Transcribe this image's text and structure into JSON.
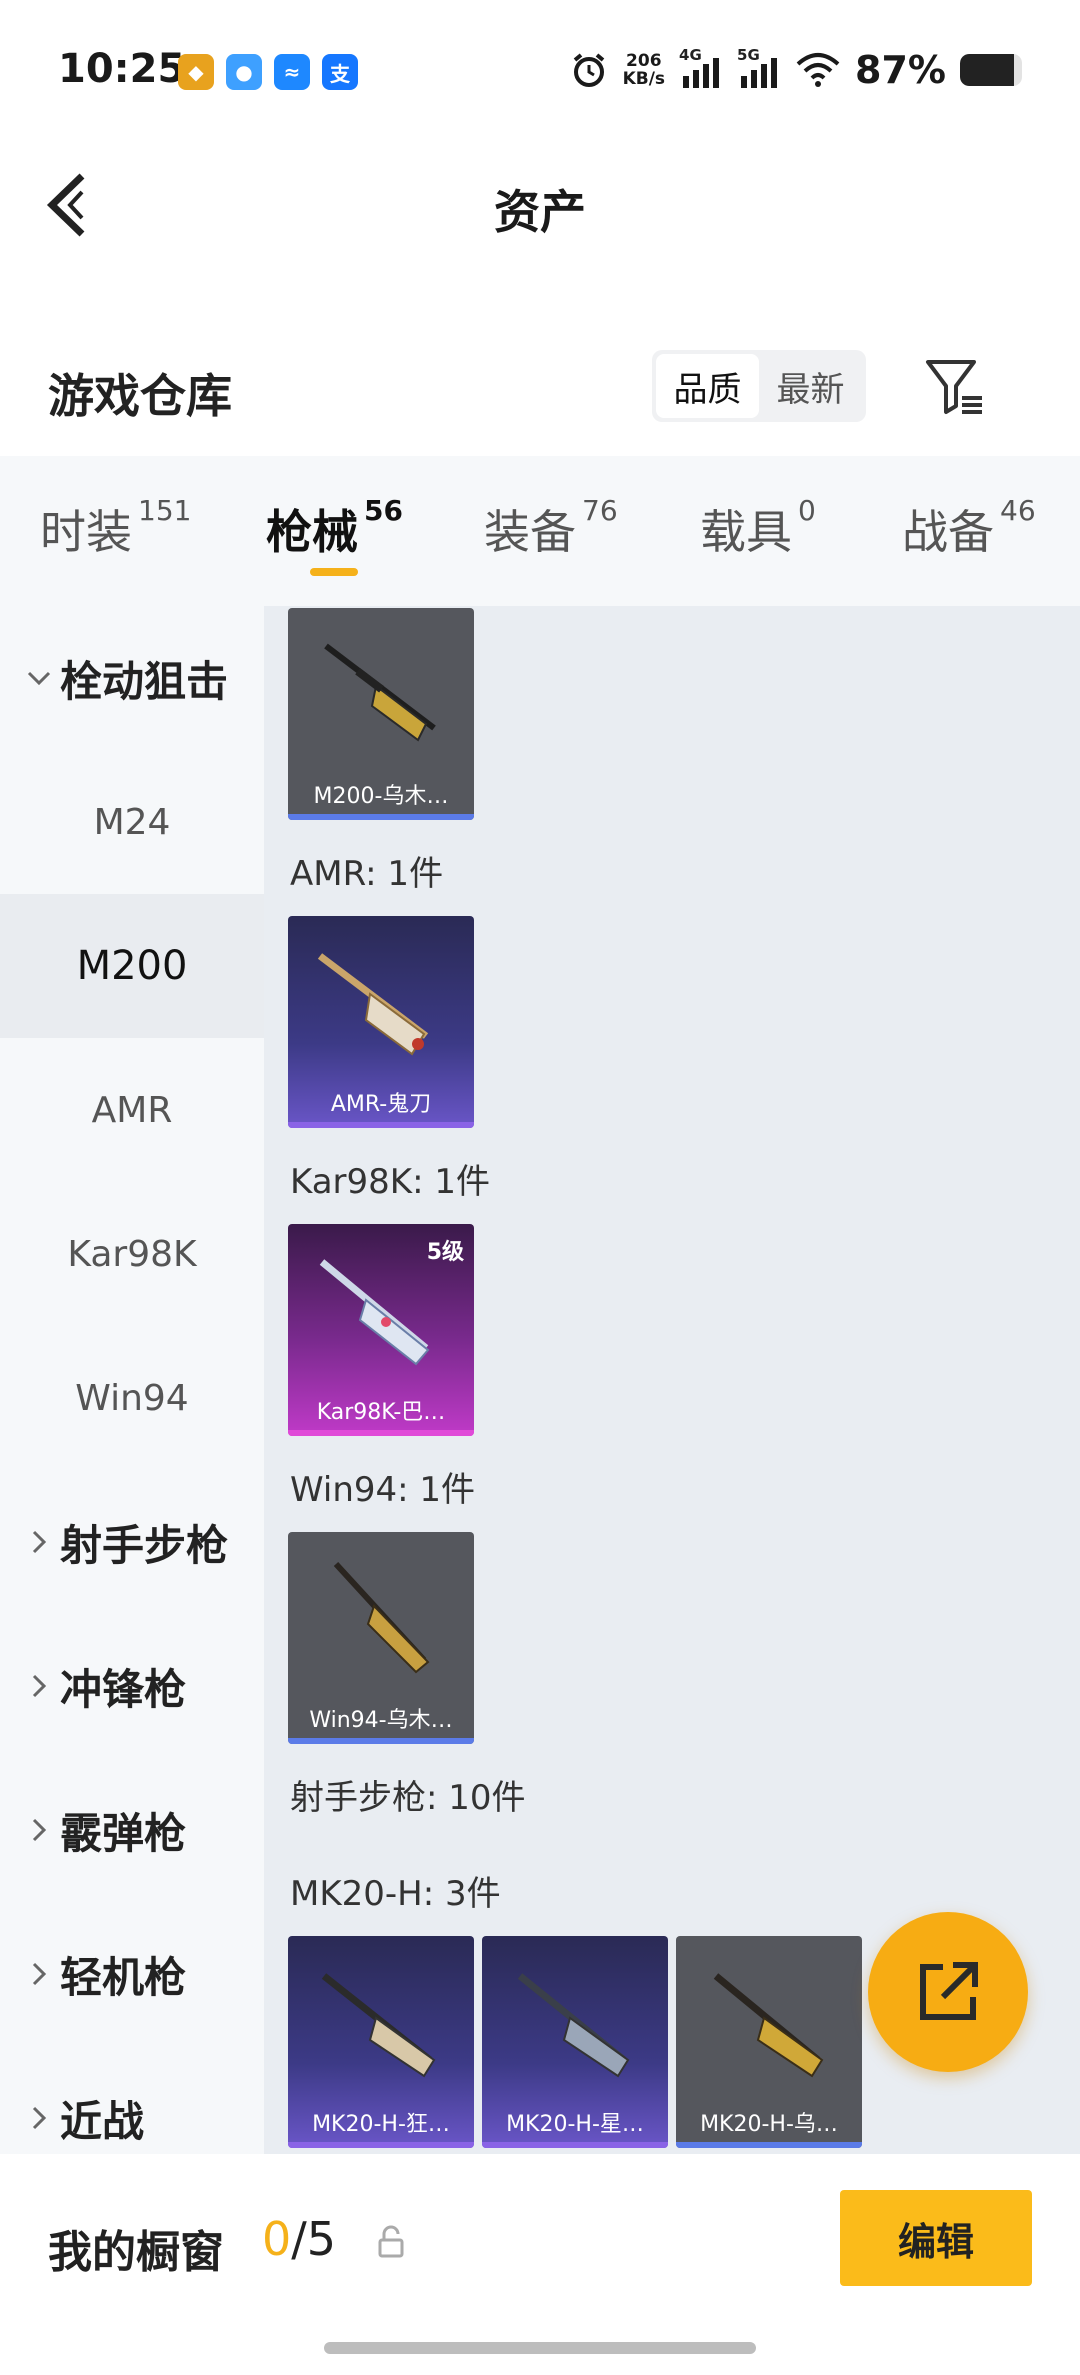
{
  "status_bar": {
    "time": "10:25",
    "speed_value": "206",
    "speed_unit": "KB/s",
    "network_1": "4G",
    "network_2": "5G",
    "battery_percent": "87%",
    "battery_level": 0.87
  },
  "header": {
    "title": "资产"
  },
  "warehouse": {
    "title": "游戏仓库",
    "sort_options": [
      "品质",
      "最新"
    ],
    "sort_selected": "品质"
  },
  "tabs": [
    {
      "label": "时装",
      "count": "151"
    },
    {
      "label": "枪械",
      "count": "56",
      "active": true
    },
    {
      "label": "装备",
      "count": "76"
    },
    {
      "label": "载具",
      "count": "0"
    },
    {
      "label": "战备",
      "count": "46"
    }
  ],
  "sidebar": {
    "group_bolt": "栓动狙击",
    "sub_items": [
      "M24",
      "M200",
      "AMR",
      "Kar98K",
      "Win94"
    ],
    "active_sub": "M200",
    "groups_rest": [
      "射手步枪",
      "冲锋枪",
      "霰弹枪",
      "轻机枪",
      "近战"
    ]
  },
  "content": {
    "m200_card": {
      "name": "M200-乌木…"
    },
    "amr_label": "AMR: 1件",
    "amr_card": {
      "name": "AMR-鬼刀"
    },
    "kar_label": "Kar98K: 1件",
    "kar_card": {
      "name": "Kar98K-巴…",
      "level": "5级"
    },
    "win_label": "Win94: 1件",
    "win_card": {
      "name": "Win94-乌木…"
    },
    "dmr_label": "射手步枪: 10件",
    "mk20_label": "MK20-H: 3件",
    "mk20_cards": [
      {
        "name": "MK20-H-狂…"
      },
      {
        "name": "MK20-H-星…"
      },
      {
        "name": "MK20-H-乌…"
      }
    ]
  },
  "bottom_bar": {
    "title": "我的橱窗",
    "count_current": "0",
    "count_total": "/5",
    "edit_label": "编辑"
  },
  "colors": {
    "accent": "#f5b11a",
    "edit_button": "#fbbb1a",
    "fab": "#f7ac13"
  }
}
